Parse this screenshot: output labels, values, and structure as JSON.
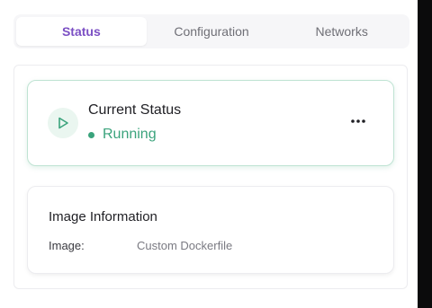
{
  "tabs": [
    {
      "label": "Status",
      "active": true
    },
    {
      "label": "Configuration",
      "active": false
    },
    {
      "label": "Networks",
      "active": false
    }
  ],
  "status_card": {
    "title": "Current Status",
    "status": "Running",
    "status_color": "#3aa37c",
    "icon": "play-icon",
    "menu_icon": "more-horizontal-icon"
  },
  "image_card": {
    "title": "Image Information",
    "label": "Image:",
    "value": "Custom Dockerfile"
  },
  "colors": {
    "accent": "#7b4fc4",
    "success": "#3aa37c"
  }
}
